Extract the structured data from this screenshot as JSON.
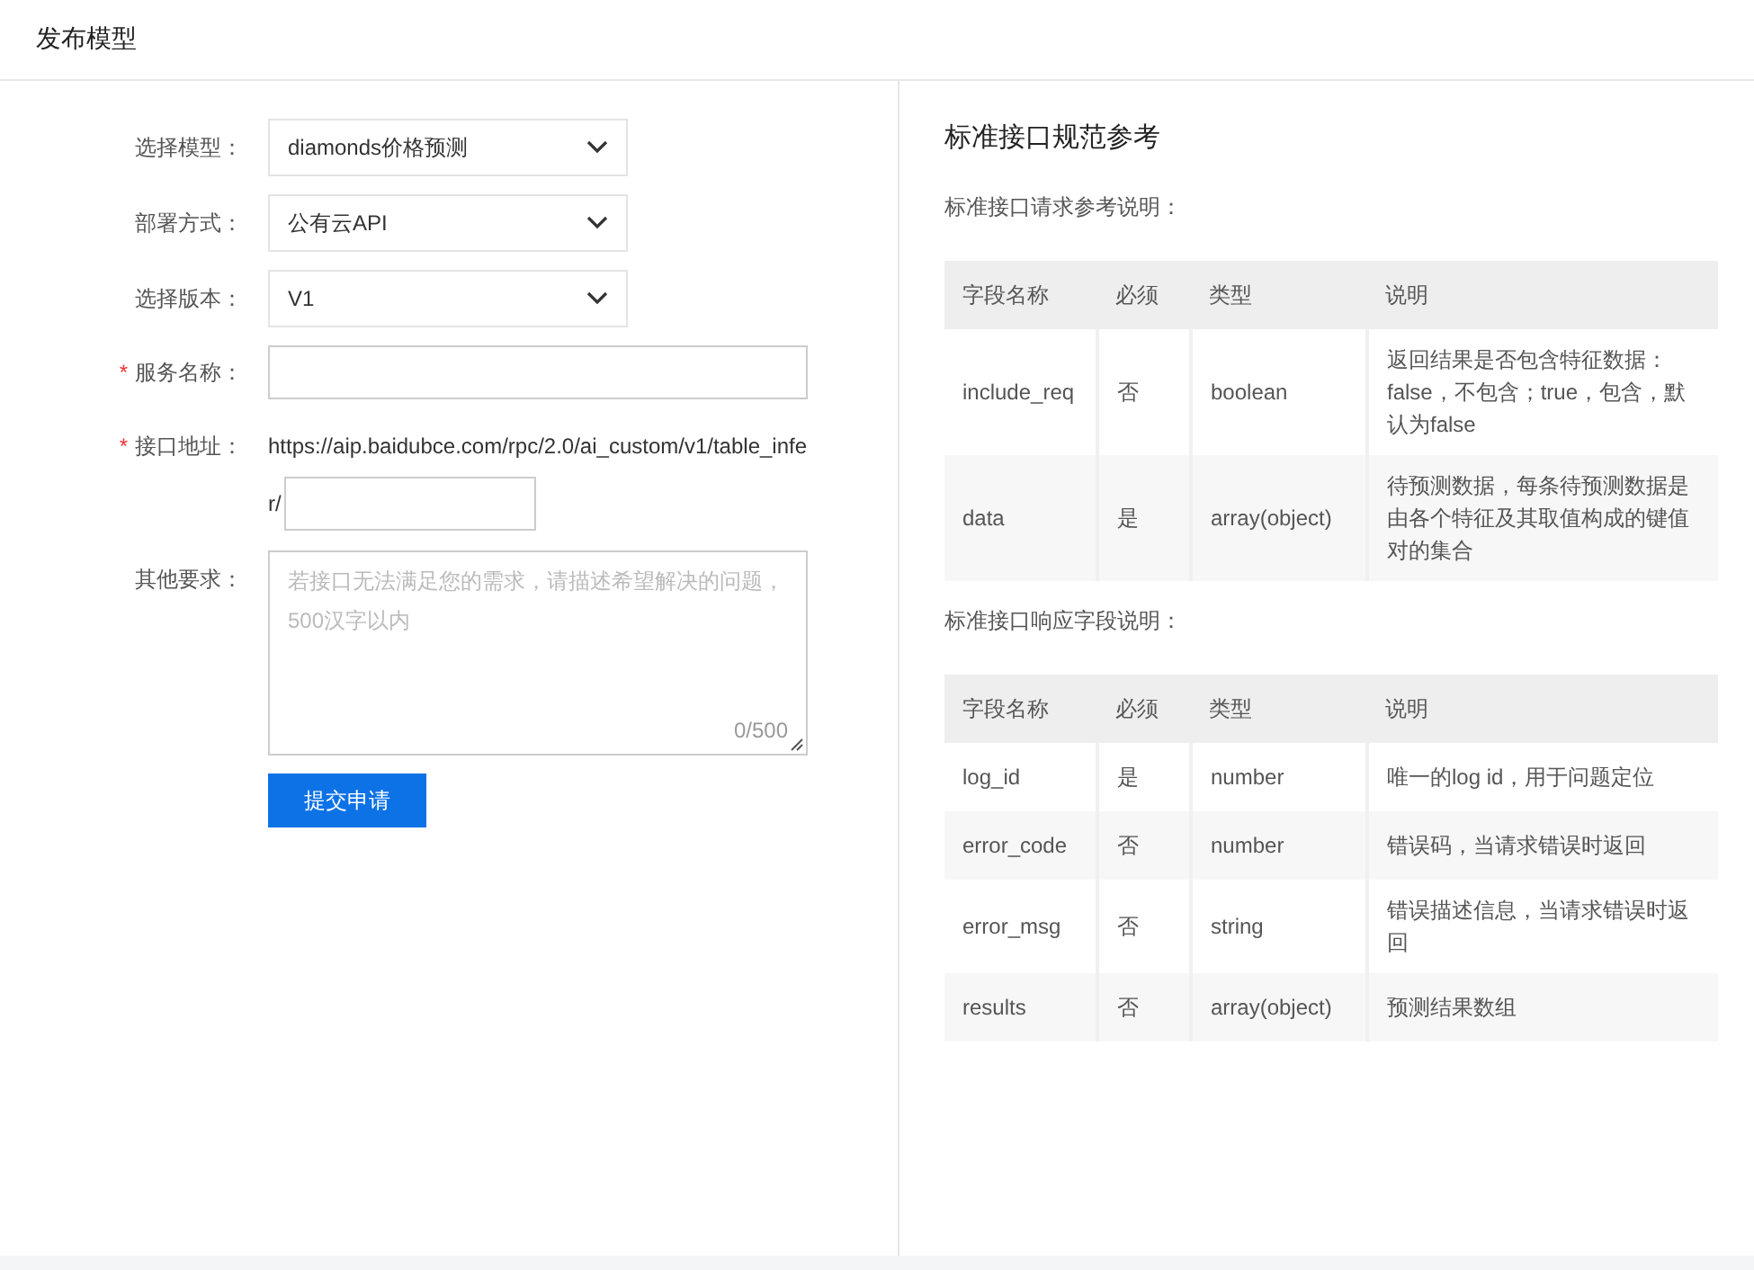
{
  "header": {
    "title": "发布模型"
  },
  "form": {
    "fields": [
      {
        "kind": "select",
        "label": "选择模型：",
        "value": "diamonds价格预测"
      },
      {
        "kind": "select",
        "label": "部署方式：",
        "value": "公有云API"
      },
      {
        "kind": "select",
        "label": "选择版本：",
        "value": "V1"
      },
      {
        "kind": "input",
        "label": "服务名称：",
        "required_mark": "*"
      },
      {
        "kind": "address",
        "label": "接口地址：",
        "required_mark": "*",
        "value_lines": [
          "https://aip.baidubce.com/rpc/2.0/ai_custom/v1/table_infe",
          "r/"
        ]
      },
      {
        "kind": "textarea",
        "label": "其他要求：",
        "placeholder": "若接口无法满足您的需求，请描述希望解决的问题，500汉字以内",
        "counter": "0/500"
      }
    ],
    "submit": "提交申请"
  },
  "reference": {
    "title": "标准接口规范参考",
    "sections": [
      {
        "heading": "标准接口请求参考说明：",
        "columns": [
          "字段名称",
          "必须",
          "类型",
          "说明"
        ],
        "rows": [
          [
            "include_req",
            "否",
            "boolean",
            "返回结果是否包含特征数据：false，不包含；true，包含，默认为false"
          ],
          [
            "data",
            "是",
            "array(object)",
            "待预测数据，每条待预测数据是由各个特征及其取值构成的键值对的集合"
          ]
        ]
      },
      {
        "heading": "标准接口响应字段说明：",
        "columns": [
          "字段名称",
          "必须",
          "类型",
          "说明"
        ],
        "rows": [
          [
            "log_id",
            "是",
            "number",
            "唯一的log id，用于问题定位"
          ],
          [
            "error_code",
            "否",
            "number",
            "错误码，当请求错误时返回"
          ],
          [
            "error_msg",
            "否",
            "string",
            "错误描述信息，当请求错误时返回"
          ],
          [
            "results",
            "否",
            "array(object)",
            "预测结果数组"
          ]
        ]
      }
    ]
  }
}
